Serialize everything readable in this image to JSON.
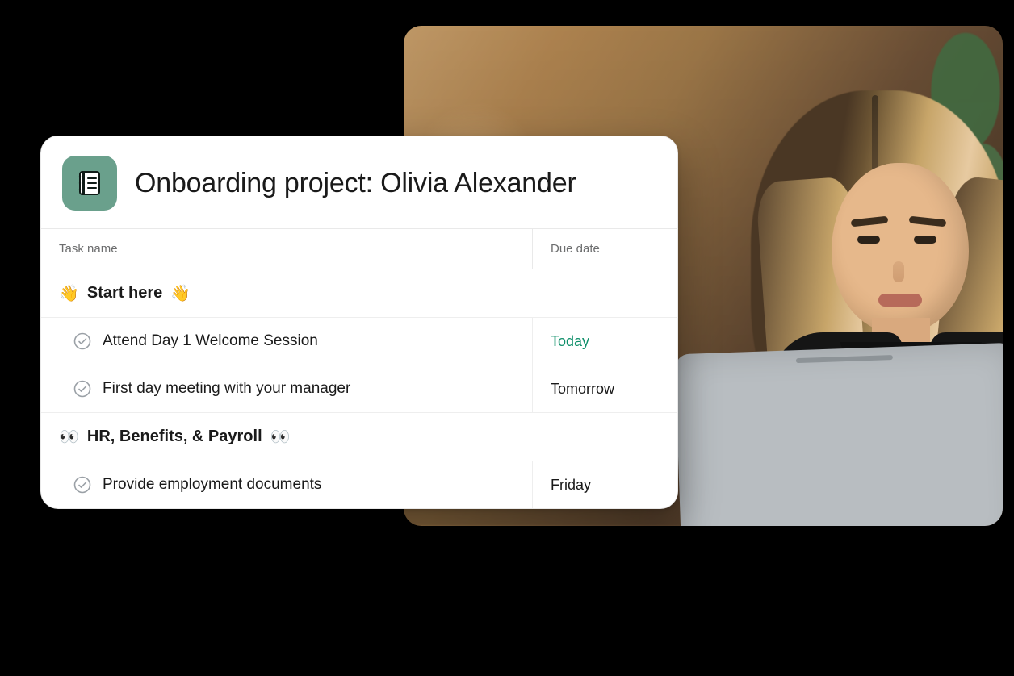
{
  "photo": {
    "alt": "Person with long hair working at a laptop in an office"
  },
  "project": {
    "title": "Onboarding project: Olivia Alexander",
    "icon": "notebook-icon",
    "accent": "#6aa08c"
  },
  "columns": {
    "task": "Task name",
    "due": "Due date"
  },
  "sections": [
    {
      "id": "start-here",
      "emoji": "👋",
      "title": "Start here",
      "tasks": [
        {
          "name": "Attend Day 1 Welcome Session",
          "due": "Today",
          "due_style": "today",
          "completed": false
        },
        {
          "name": "First day meeting with your manager",
          "due": "Tomorrow",
          "due_style": "normal",
          "completed": false
        }
      ]
    },
    {
      "id": "hr-benefits-payroll",
      "emoji": "👀",
      "title": "HR, Benefits, & Payroll",
      "tasks": [
        {
          "name": "Provide employment documents",
          "due": "Friday",
          "due_style": "normal",
          "completed": false
        }
      ]
    }
  ]
}
